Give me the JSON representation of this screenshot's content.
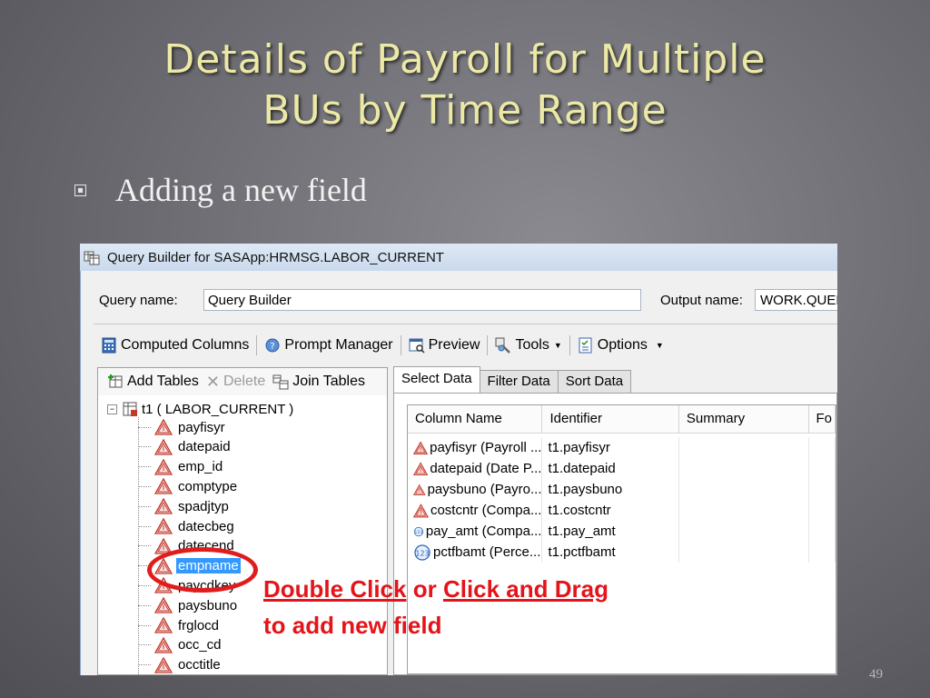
{
  "slide": {
    "title_line1": "Details of Payroll for Multiple",
    "title_line2": "BUs by Time Range",
    "bullet": "Adding a new field",
    "page_number": "49"
  },
  "window": {
    "title": "Query Builder for SASApp:HRMSG.LABOR_CURRENT",
    "query_name_label": "Query name:",
    "query_name_value": "Query Builder",
    "output_name_label": "Output name:",
    "output_name_value": "WORK.QUERY_"
  },
  "toolbar": {
    "computed_columns": "Computed Columns",
    "prompt_manager": "Prompt Manager",
    "preview": "Preview",
    "tools": "Tools",
    "options": "Options"
  },
  "left_pane": {
    "add_tables": "Add Tables",
    "delete": "Delete",
    "join_tables": "Join Tables",
    "root": "t1 ( LABOR_CURRENT )",
    "fields": [
      "payfisyr",
      "datepaid",
      "emp_id",
      "comptype",
      "spadjtyp",
      "datecbeg",
      "datecend",
      "empname",
      "paycdkey",
      "paysbuno",
      "frglocd",
      "occ_cd",
      "occtitle"
    ],
    "selected_index": 7
  },
  "tabs": [
    "Select Data",
    "Filter Data",
    "Sort Data"
  ],
  "grid": {
    "columns": [
      "Column Name",
      "Identifier",
      "Summary",
      "Fo"
    ],
    "rows": [
      {
        "name": "payfisyr (Payroll ...",
        "id": "t1.payfisyr",
        "icon": "character-icon"
      },
      {
        "name": "datepaid (Date P...",
        "id": "t1.datepaid",
        "icon": "character-icon"
      },
      {
        "name": "paysbuno (Payro...",
        "id": "t1.paysbuno",
        "icon": "character-icon"
      },
      {
        "name": "costcntr (Compa...",
        "id": "t1.costcntr",
        "icon": "character-icon"
      },
      {
        "name": "pay_amt (Compa...",
        "id": "t1.pay_amt",
        "icon": "numeric-icon"
      },
      {
        "name": "pctfbamt (Perce...",
        "id": "t1.pctfbamt",
        "icon": "numeric-icon"
      }
    ]
  },
  "annotation": {
    "part1": "Double Click",
    "part2": " or ",
    "part3": "Click and Drag ",
    "line2": "to add new field"
  },
  "colors": {
    "title": "#ece9a6",
    "annotation": "#e3141a",
    "selection": "#3399ff"
  }
}
